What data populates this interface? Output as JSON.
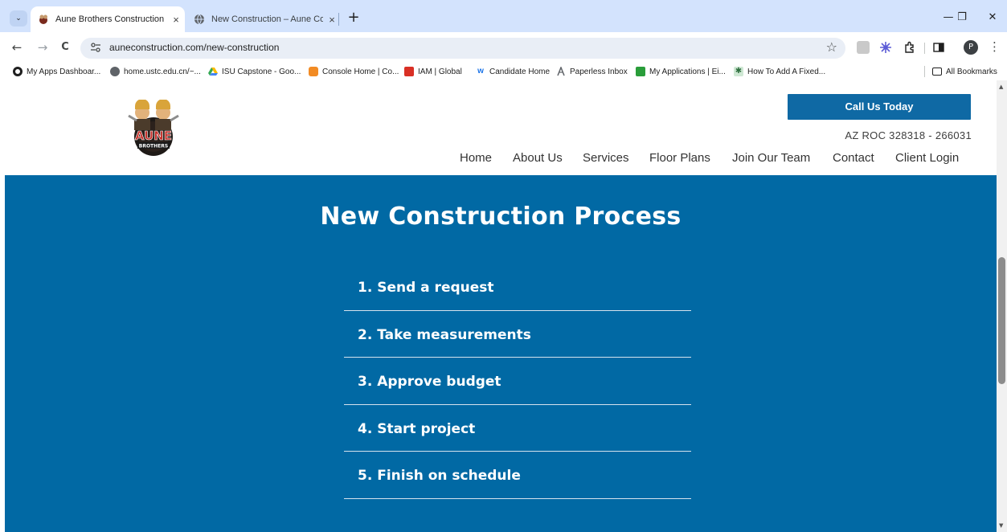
{
  "browser": {
    "tabs": [
      {
        "title": "Aune Brothers Construction",
        "active": true
      },
      {
        "title": "New Construction – Aune Cons",
        "active": false
      }
    ],
    "tab_search_glyph": "⌄",
    "new_tab_glyph": "+",
    "close_glyph": "×",
    "window_controls": {
      "minimize": "—",
      "restore": "❐",
      "close": "✕"
    },
    "nav": {
      "back": "←",
      "forward": "→",
      "reload": "C"
    },
    "url": "auneconstruction.com/new-construction",
    "star_glyph": "☆",
    "profile_initial": "P",
    "menu_glyph": "⋮",
    "bookmarks": [
      "My Apps Dashboar...",
      "home.ustc.edu.cn/~...",
      "ISU Capstone - Goo...",
      "Console Home | Co...",
      "IAM | Global",
      "Candidate Home",
      "Paperless Inbox",
      "My Applications | Ei...",
      "How To Add A Fixed..."
    ],
    "all_bookmarks": "All Bookmarks"
  },
  "site": {
    "cta_label": "Call Us Today",
    "license": "AZ ROC 328318 - 266031",
    "logo_text": "AUNE",
    "logo_subtext": "BROTHERS",
    "nav": [
      "Home",
      "About Us",
      "Services",
      "Floor Plans",
      "Join Our Team",
      "Contact",
      "Client Login"
    ],
    "hero": {
      "title": "New Construction Process",
      "steps": [
        "1. Send a request",
        "2. Take measurements",
        "3. Approve budget",
        "4. Start project",
        "5. Finish on schedule"
      ]
    }
  },
  "colors": {
    "hero_blue": "#0169a4",
    "cta_blue": "#0f69a4",
    "tabstrip": "#d3e3fd"
  }
}
